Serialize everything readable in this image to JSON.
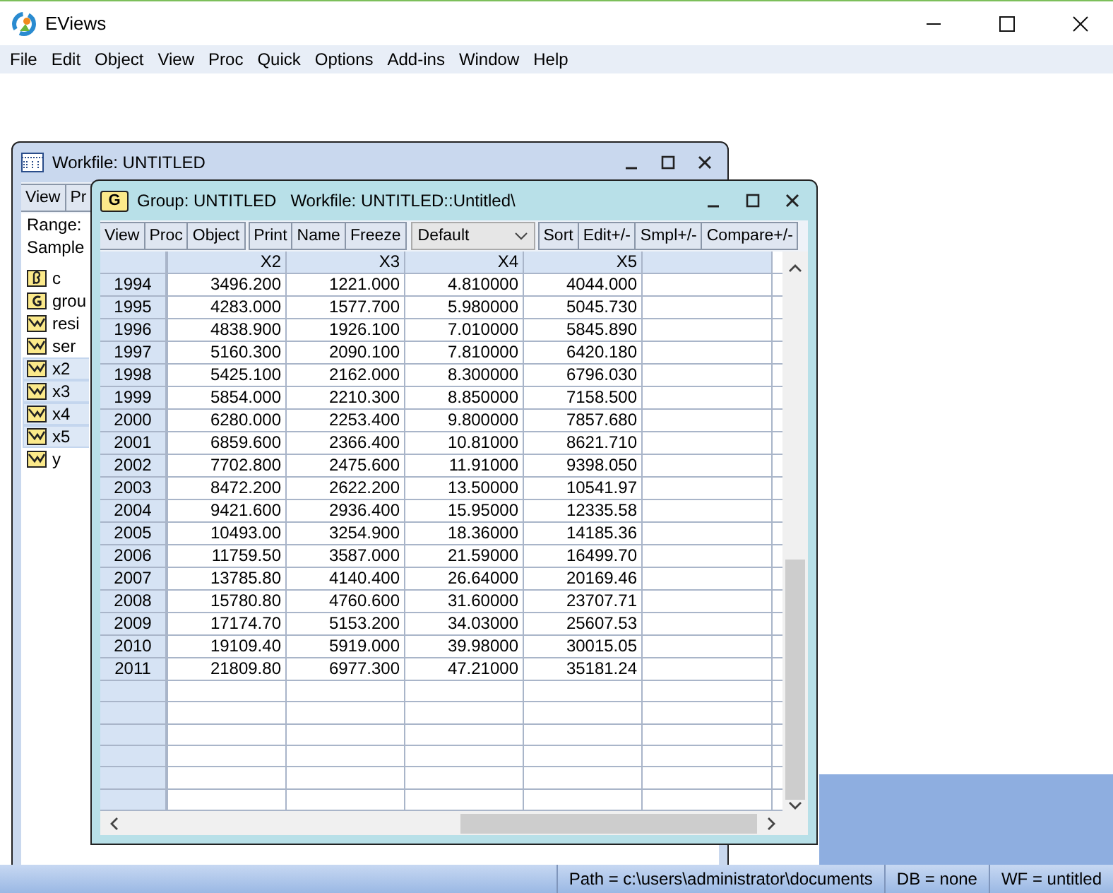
{
  "app": {
    "title": "EViews",
    "menu": [
      "File",
      "Edit",
      "Object",
      "View",
      "Proc",
      "Quick",
      "Options",
      "Add-ins",
      "Window",
      "Help"
    ]
  },
  "workfile": {
    "title": "Workfile: UNTITLED",
    "toolbar": [
      "View",
      "Pr"
    ],
    "range_label": "Range:",
    "sample_label": "Sample",
    "objects": [
      {
        "name": "c",
        "kind": "coef",
        "selected": false
      },
      {
        "name": "grou",
        "kind": "group",
        "selected": false
      },
      {
        "name": "resi",
        "kind": "series",
        "selected": false
      },
      {
        "name": "ser",
        "kind": "series",
        "selected": false
      },
      {
        "name": "x2",
        "kind": "series",
        "selected": true
      },
      {
        "name": "x3",
        "kind": "series",
        "selected": true
      },
      {
        "name": "x4",
        "kind": "series",
        "selected": true
      },
      {
        "name": "x5",
        "kind": "series",
        "selected": true
      },
      {
        "name": "y",
        "kind": "series",
        "selected": false
      }
    ]
  },
  "group": {
    "icon_letter": "G",
    "title": "Group: UNTITLED   Workfile: UNTITLED::Untitled\\",
    "toolbar": [
      [
        "View",
        "Proc",
        "Object"
      ],
      [
        "Print",
        "Name",
        "Freeze"
      ],
      [
        "Sort",
        "Edit+/-",
        "Smpl+/-",
        "Compare+/-"
      ]
    ],
    "view_select": "Default",
    "columns": [
      "",
      "X2",
      "X3",
      "X4",
      "X5"
    ],
    "rows": [
      [
        "1994",
        "3496.200",
        "1221.000",
        "4.810000",
        "4044.000"
      ],
      [
        "1995",
        "4283.000",
        "1577.700",
        "5.980000",
        "5045.730"
      ],
      [
        "1996",
        "4838.900",
        "1926.100",
        "7.010000",
        "5845.890"
      ],
      [
        "1997",
        "5160.300",
        "2090.100",
        "7.810000",
        "6420.180"
      ],
      [
        "1998",
        "5425.100",
        "2162.000",
        "8.300000",
        "6796.030"
      ],
      [
        "1999",
        "5854.000",
        "2210.300",
        "8.850000",
        "7158.500"
      ],
      [
        "2000",
        "6280.000",
        "2253.400",
        "9.800000",
        "7857.680"
      ],
      [
        "2001",
        "6859.600",
        "2366.400",
        "10.81000",
        "8621.710"
      ],
      [
        "2002",
        "7702.800",
        "2475.600",
        "11.91000",
        "9398.050"
      ],
      [
        "2003",
        "8472.200",
        "2622.200",
        "13.50000",
        "10541.97"
      ],
      [
        "2004",
        "9421.600",
        "2936.400",
        "15.95000",
        "12335.58"
      ],
      [
        "2005",
        "10493.00",
        "3254.900",
        "18.36000",
        "14185.36"
      ],
      [
        "2006",
        "11759.50",
        "3587.000",
        "21.59000",
        "16499.70"
      ],
      [
        "2007",
        "13785.80",
        "4140.400",
        "26.64000",
        "20169.46"
      ],
      [
        "2008",
        "15780.80",
        "4760.600",
        "31.60000",
        "23707.71"
      ],
      [
        "2009",
        "17174.70",
        "5153.200",
        "34.03000",
        "25607.53"
      ],
      [
        "2010",
        "19109.40",
        "5919.000",
        "39.98000",
        "30015.05"
      ],
      [
        "2011",
        "21809.80",
        "6977.300",
        "47.21000",
        "35181.24"
      ]
    ]
  },
  "status_bar": [
    "Path = c:\\users\\administrator\\documents",
    "DB = none",
    "WF = untitled"
  ]
}
